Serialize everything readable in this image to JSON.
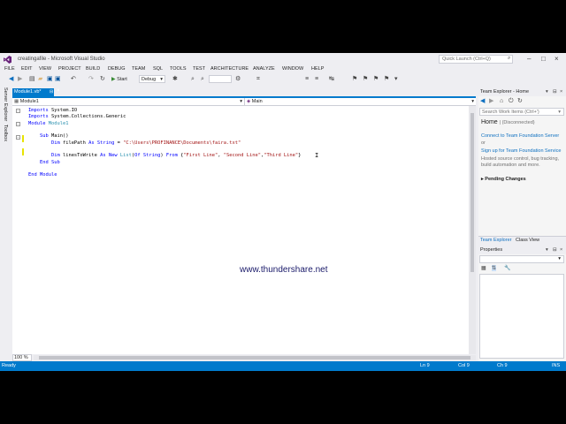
{
  "window": {
    "title": "creatingafile - Microsoft Visual Studio",
    "quick_launch_placeholder": "Quick Launch (Ctrl+Q)"
  },
  "menu": [
    "FILE",
    "EDIT",
    "VIEW",
    "PROJECT",
    "BUILD",
    "DEBUG",
    "TEAM",
    "SQL",
    "TOOLS",
    "TEST",
    "ARCHITECTURE",
    "ANALYZE",
    "WINDOW",
    "HELP"
  ],
  "toolbar": {
    "start_label": "Start",
    "config_value": "Debug"
  },
  "left_tabs": [
    "Server Explorer",
    "Toolbox"
  ],
  "document": {
    "tab_label": "Module1.vb*",
    "nav_left": "Module1",
    "nav_right": "Main"
  },
  "code_lines": [
    [
      {
        "t": "Imports ",
        "c": "kw"
      },
      {
        "t": "System.IO",
        "c": ""
      }
    ],
    [
      {
        "t": "Imports ",
        "c": "kw"
      },
      {
        "t": "System.Collections.Generic",
        "c": ""
      }
    ],
    [
      {
        "t": "Module ",
        "c": "kw"
      },
      {
        "t": "Module1",
        "c": "ty"
      }
    ],
    [],
    [
      {
        "t": "    ",
        "c": ""
      },
      {
        "t": "Sub ",
        "c": "kw"
      },
      {
        "t": "Main()",
        "c": ""
      }
    ],
    [
      {
        "t": "        ",
        "c": ""
      },
      {
        "t": "Dim ",
        "c": "kw"
      },
      {
        "t": "filePath ",
        "c": ""
      },
      {
        "t": "As ",
        "c": "kw"
      },
      {
        "t": "String",
        "c": "kw"
      },
      {
        "t": " = ",
        "c": ""
      },
      {
        "t": "\"C:\\Users\\PROFINANCE\\Documents\\faira.txt\"",
        "c": "str"
      }
    ],
    [],
    [
      {
        "t": "        ",
        "c": ""
      },
      {
        "t": "Dim ",
        "c": "kw"
      },
      {
        "t": "linesToWrite ",
        "c": ""
      },
      {
        "t": "As New ",
        "c": "kw"
      },
      {
        "t": "List",
        "c": "ty"
      },
      {
        "t": "(",
        "c": ""
      },
      {
        "t": "Of String",
        "c": "kw"
      },
      {
        "t": ") ",
        "c": ""
      },
      {
        "t": "From ",
        "c": "kw"
      },
      {
        "t": "{",
        "c": ""
      },
      {
        "t": "\"First Line\"",
        "c": "str"
      },
      {
        "t": ", ",
        "c": ""
      },
      {
        "t": "\"Second Line\"",
        "c": "str"
      },
      {
        "t": ",",
        "c": ""
      },
      {
        "t": "\"Third Line\"",
        "c": "str"
      },
      {
        "t": "}",
        "c": ""
      }
    ],
    [
      {
        "t": "    ",
        "c": ""
      },
      {
        "t": "End Sub",
        "c": "kw"
      }
    ],
    [],
    [
      {
        "t": "End Module",
        "c": "kw"
      }
    ]
  ],
  "watermark": "www.thundershare.net",
  "zoom": "100 %",
  "team_explorer": {
    "header": "Team Explorer - Home",
    "search_placeholder": "Search Work Items (Ctrl+')",
    "home_title": "Home",
    "home_sub": "| (Disconnected)",
    "link_connect": "Connect to Team Foundation Server",
    "or_text": "or",
    "link_signup": "Sign up for Team Foundation Service",
    "desc_line1": "Hosted source control, bug tracking,",
    "desc_line2": "build automation and more.",
    "pending": "Pending Changes",
    "tab_team": "Team Explorer",
    "tab_class": "Class View"
  },
  "properties": {
    "header": "Properties"
  },
  "status": {
    "ready": "Ready",
    "ln": "Ln 9",
    "col": "Col 9",
    "ch": "Ch 9",
    "ins": "INS"
  },
  "colors": {
    "accent": "#007acc",
    "keyword": "#0000ff",
    "type": "#2b91af",
    "string": "#a31515"
  }
}
